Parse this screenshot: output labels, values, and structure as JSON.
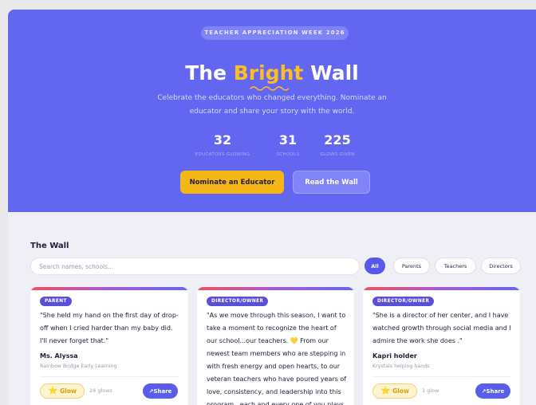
{
  "hero": {
    "pill": "TEACHER APPRECIATION WEEK 2026",
    "title_before": "The ",
    "title_highlight": "Bright",
    "title_after": " Wall",
    "subtitle_line1": "Celebrate the educators who changed everything. Nominate an",
    "subtitle_line2": "educator and share your story with the world.",
    "highlight_color": "#fbbf24",
    "background_color": "#6366f1"
  },
  "stats": [
    {
      "value": "32",
      "label": "EDUCATORS GLOWING"
    },
    {
      "value": "31",
      "label": "SCHOOLS"
    },
    {
      "value": "225",
      "label": "GLOWS GIVEN"
    }
  ],
  "actions": {
    "nominate": "Nominate an Educator",
    "read": "Read the Wall"
  },
  "wall": {
    "title": "The Wall",
    "search_placeholder": "Search names, schools...",
    "filters": [
      "All",
      "Parents",
      "Teachers",
      "Directors"
    ],
    "active_filter": "All"
  },
  "cards": [
    {
      "badge": "PARENT",
      "quote_lines": [
        "\"She held my hand on the first day of drop-",
        "off when I cried harder than my baby did.",
        "I'll never forget that.\""
      ],
      "name": "Ms. Alyssa",
      "school": "Rainbow Bridge Early Learning",
      "glow_label": "Glow",
      "glow_icon": "star-icon",
      "glow_count": "24 glows",
      "share_label": "Share",
      "share_icon": "share-arrow-icon"
    },
    {
      "badge": "DIRECTOR/OWNER",
      "quote_lines": [
        "\"As we move through this season, I want to",
        "take a moment to recognize the heart of",
        "our school...our teachers. 💛 From our",
        "newest team members who are stepping in",
        "with fresh energy and open hearts, to our",
        "veteran teachers who have poured years of",
        "love, consistency, and leadership into this",
        "program...each and every one of you plays"
      ]
    },
    {
      "badge": "DIRECTOR/OWNER",
      "quote_lines": [
        "\"She is a director of her center, and I have",
        "watched growth through social media and I",
        "admire the work she does .\""
      ],
      "name": "Kapri holder",
      "school": "Krystals helping hands",
      "glow_label": "Glow",
      "glow_icon": "star-icon",
      "glow_count": "1 glow",
      "share_label": "Share",
      "share_icon": "share-arrow-icon"
    }
  ]
}
